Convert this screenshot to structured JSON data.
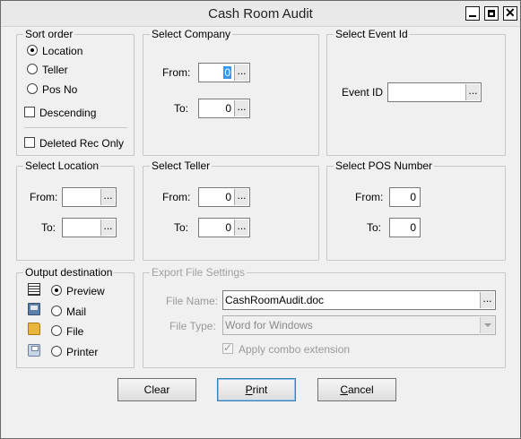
{
  "window": {
    "title": "Cash Room Audit"
  },
  "sort_order": {
    "legend": "Sort order",
    "options": [
      "Location",
      "Teller",
      "Pos No"
    ],
    "selected": "Location",
    "descending_label": "Descending",
    "descending_checked": false,
    "deleted_label": "Deleted Rec Only",
    "deleted_checked": false
  },
  "select_company": {
    "legend": "Select Company",
    "from_label": "From:",
    "from_value": "0",
    "to_label": "To:",
    "to_value": "0",
    "browse": "..."
  },
  "select_event": {
    "legend": "Select Event Id",
    "label": "Event ID",
    "value": "",
    "browse": "..."
  },
  "select_location": {
    "legend": "Select Location",
    "from_label": "From:",
    "from_value": "",
    "to_label": "To:",
    "to_value": "",
    "browse": "..."
  },
  "select_teller": {
    "legend": "Select Teller",
    "from_label": "From:",
    "from_value": "0",
    "to_label": "To:",
    "to_value": "0",
    "browse": "..."
  },
  "select_pos": {
    "legend": "Select POS Number",
    "from_label": "From:",
    "from_value": "0",
    "to_label": "To:",
    "to_value": "0"
  },
  "output": {
    "legend": "Output destination",
    "options": [
      "Preview",
      "Mail",
      "File",
      "Printer"
    ],
    "selected": "Preview",
    "icons": [
      "preview-icon",
      "mail-icon",
      "file-icon",
      "printer-icon"
    ]
  },
  "export": {
    "legend": "Export  File Settings",
    "file_name_label": "File Name:",
    "file_name_value": "CashRoomAudit.doc",
    "browse": "...",
    "file_type_label": "File Type:",
    "file_type_value": "Word for Windows",
    "combo_label": "Apply combo extension",
    "combo_checked": true
  },
  "buttons": {
    "clear": "Clear",
    "print_underline": "P",
    "print_rest": "rint",
    "cancel_underline": "C",
    "cancel_rest": "ancel"
  }
}
